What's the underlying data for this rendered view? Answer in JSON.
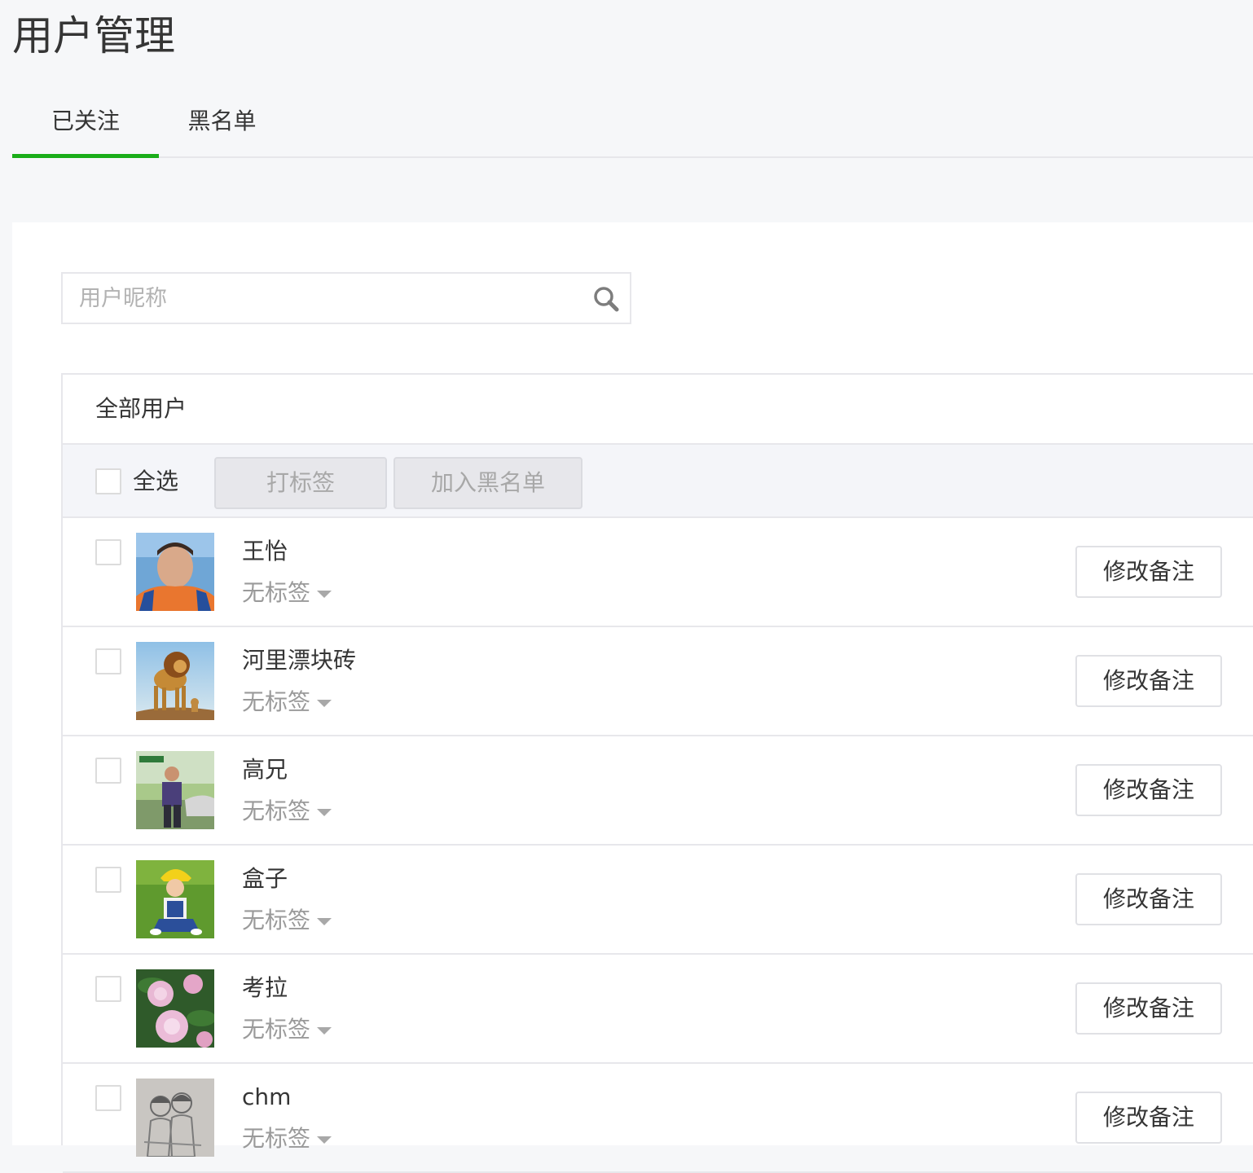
{
  "page": {
    "title": "用户管理"
  },
  "tabs": [
    {
      "label": "已关注",
      "active": true
    },
    {
      "label": "黑名单",
      "active": false
    }
  ],
  "search": {
    "placeholder": "用户昵称",
    "value": ""
  },
  "user_table": {
    "header": "全部用户",
    "select_all_label": "全选",
    "tag_button_label": "打标签",
    "blacklist_button_label": "加入黑名单",
    "remark_button_label": "修改备注",
    "users": [
      {
        "nickname": "王怡",
        "tag": "无标签",
        "avatar": "portrait-woman-orange-apron"
      },
      {
        "nickname": "河里漂块砖",
        "tag": "无标签",
        "avatar": "lion-and-cub"
      },
      {
        "nickname": "高兄",
        "tag": "无标签",
        "avatar": "man-standing-outdoors"
      },
      {
        "nickname": "盒子",
        "tag": "无标签",
        "avatar": "child-on-grass"
      },
      {
        "nickname": "考拉",
        "tag": "无标签",
        "avatar": "pink-peonies"
      },
      {
        "nickname": "chm",
        "tag": "无标签",
        "avatar": "pencil-sketch-kids"
      }
    ]
  },
  "colors": {
    "accent": "#1aad19",
    "border": "#e7e7eb",
    "muted_text": "#9a9a9a"
  }
}
